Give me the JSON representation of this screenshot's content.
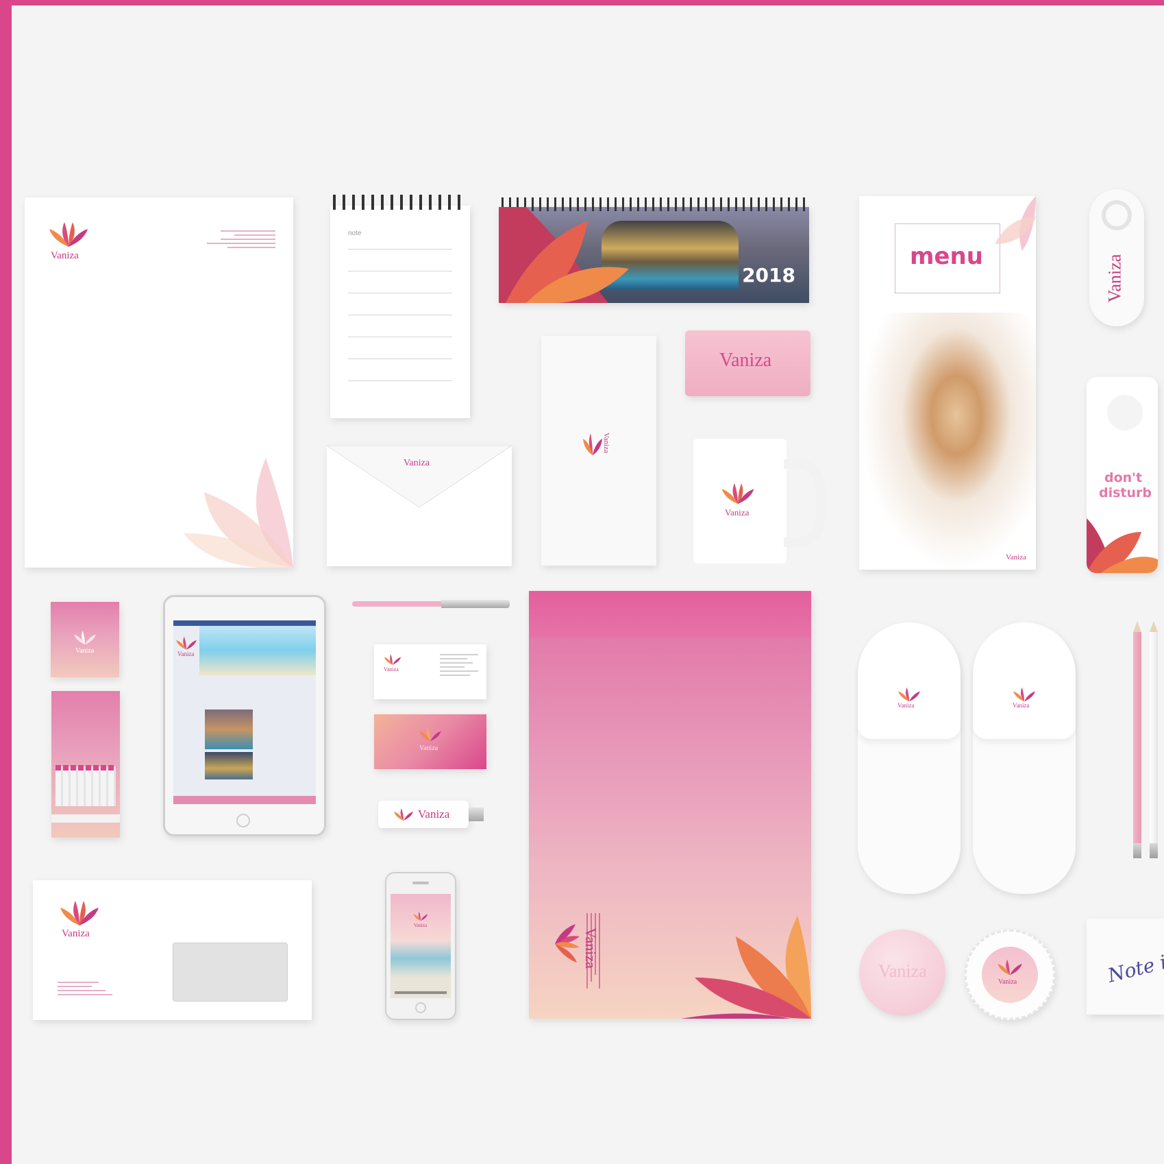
{
  "brand": {
    "name": "Vaniza",
    "colors": {
      "accent": "#d9478a",
      "pink": "#e37fac",
      "peach": "#f2c9bd",
      "orange": "#f08a4b",
      "magenta": "#c33c82"
    }
  },
  "letterhead": {
    "logo": "Vaniza"
  },
  "notepad": {
    "label": "note"
  },
  "calendar": {
    "year": "2018"
  },
  "wet_wipe": {
    "logo": "Vaniza"
  },
  "envelope_small": {
    "logo": "Vaniza"
  },
  "menu": {
    "title": "menu",
    "logo": "Vaniza"
  },
  "opener": {
    "logo": "Vaniza"
  },
  "door_hanger": {
    "line1": "don't",
    "line2": "disturb"
  },
  "matchbox": {
    "logo": "Vaniza"
  },
  "business_card": {
    "logo": "Vaniza"
  },
  "card_back": {
    "logo": "Vaniza"
  },
  "usb": {
    "logo": "Vaniza"
  },
  "mug": {
    "logo": "Vaniza"
  },
  "towel": {
    "logo": "Vaniza"
  },
  "tablet": {
    "logo": "Vaniza"
  },
  "big_envelope": {
    "logo": "Vaniza"
  },
  "slippers": {
    "logo": "Vaniza"
  },
  "window_envelope": {
    "logo": "Vaniza"
  },
  "phone": {
    "logo": "Vaniza"
  },
  "soap": {
    "logo": "Vaniza"
  },
  "soap_box": {
    "logo": "Vaniza"
  },
  "sticky_note": {
    "text": "Note it!"
  }
}
